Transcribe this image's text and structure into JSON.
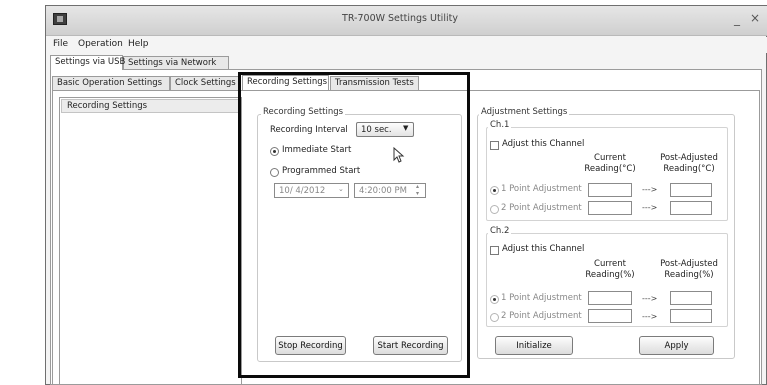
{
  "window": {
    "title": "TR-700W  Settings Utility",
    "minimize": "_",
    "close": "×"
  },
  "menu": {
    "file": "File",
    "operation": "Operation",
    "help": "Help"
  },
  "outer_tabs": {
    "usb": "Settings via USB",
    "network": "Settings via Network"
  },
  "inner_tabs": {
    "basic": "Basic Operation Settings",
    "clock": "Clock Settings",
    "recording": "Recording Settings",
    "transmission": "Transmission Tests"
  },
  "left_list": {
    "item": "Recording Settings"
  },
  "recording": {
    "group_label": "Recording Settings",
    "interval_label": "Recording Interval",
    "interval_value": "10 sec.",
    "immediate_start": "Immediate Start",
    "programmed_start": "Programmed Start",
    "date": "10/ 4/2012",
    "time": "4:20:00 PM",
    "stop_button": "Stop Recording",
    "start_button": "Start Recording"
  },
  "adjustment": {
    "group_label": "Adjustment Settings",
    "ch1": {
      "label": "Ch.1",
      "adjust_label": "Adjust this Channel",
      "current_header": "Current\nReading(°C)",
      "post_header": "Post-Adjusted\nReading(°C)",
      "one_point": "1 Point Adjustment",
      "two_point": "2 Point Adjustment"
    },
    "ch2": {
      "label": "Ch.2",
      "adjust_label": "Adjust this Channel",
      "current_header": "Current\nReading(%)",
      "post_header": "Post-Adjusted\nReading(%)",
      "one_point": "1 Point Adjustment",
      "two_point": "2 Point Adjustment"
    },
    "arrow": "--->",
    "initialize_button": "Initialize",
    "apply_button": "Apply"
  }
}
